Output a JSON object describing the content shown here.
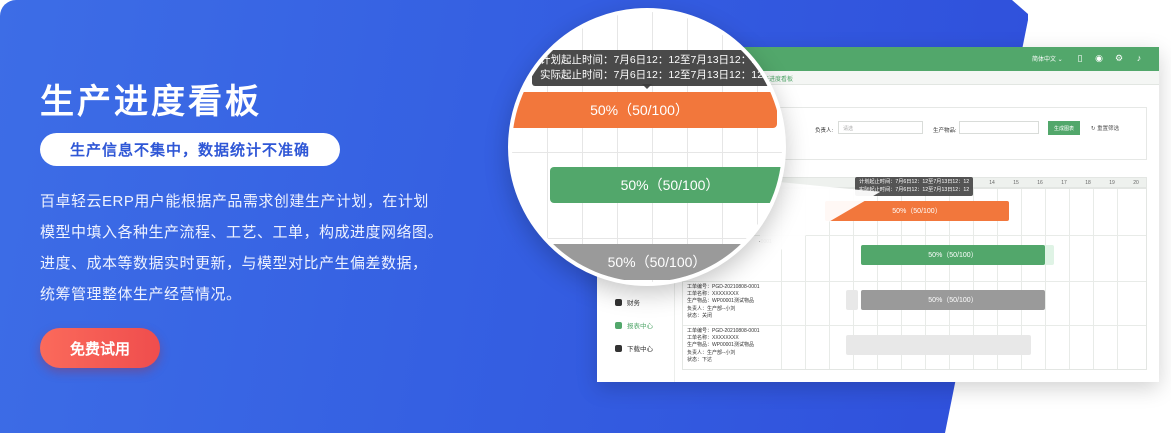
{
  "hero": {
    "title": "生产进度看板",
    "pill": "生产信息不集中，数据统计不准确",
    "desc_lines": [
      "百卓轻云ERP用户能根据产品需求创建生产计划，在计划",
      "模型中填入各种生产流程、工艺、工单，构成进度网络图。",
      "进度、成本等数据实时更新，与模型对比产生偏差数据，",
      "统筹管理整体生产经营情况。"
    ],
    "cta": "免费试用",
    "colors": {
      "bg_start": "#3d6de6",
      "bg_end": "#2f4fdb",
      "cta": "#f05a4f"
    }
  },
  "app": {
    "topbar": {
      "lang": "简体中文",
      "icons": [
        "phone-icon",
        "globe-icon",
        "gear-icon",
        "bell-icon"
      ]
    },
    "tab": "生产进度看板",
    "sidebar": [
      {
        "label": "财务",
        "icon": "finance-icon",
        "active": false
      },
      {
        "label": "报表中心",
        "icon": "report-icon",
        "active": true
      },
      {
        "label": "下载中心",
        "icon": "download-icon",
        "active": false
      }
    ],
    "filters": {
      "owner_label": "负责人:",
      "owner_placeholder": "请选",
      "product_label": "生产物品:",
      "generate_button": "生成图表",
      "reset_label": "重置筛选"
    },
    "gantt": {
      "days": [
        "14",
        "15",
        "16",
        "17",
        "18",
        "19",
        "20"
      ],
      "tooltip_lines": [
        "计划起止时间：7月6日12：12至7月13日12：12",
        "实际起止时间：7月6日12：12至7月13日12：12"
      ],
      "bars": [
        {
          "label": "50%（50/100）",
          "color": "orange"
        },
        {
          "label": "50%（50/100）",
          "color": "green"
        },
        {
          "label": "50%（50/100）",
          "color": "gray"
        }
      ],
      "rows": [
        {
          "lines": [
            "工单编号：PGD-20210808-0001",
            "工单名称：XXXXXXXX",
            "生产物品：WP00001测试物品",
            "负责人：生产部--小刘",
            "状态：关闭"
          ]
        },
        {
          "lines": [
            "工单编号：PGD-20210808-0001",
            "工单名称：XXXXXXXX",
            "生产物品：WP00001测试物品",
            "负责人：生产部--小刘",
            "状态：下达"
          ]
        }
      ],
      "row0_fragment": "-0001"
    },
    "lens": {
      "tooltip_lines": [
        "计划起止时间：7月6日12：12至7月13日12：12",
        "实际起止时间：7月6日12：12至7月13日12：12"
      ],
      "bars": [
        "50%（50/100）",
        "50%（50/100）",
        "50%（50/100）"
      ]
    }
  }
}
